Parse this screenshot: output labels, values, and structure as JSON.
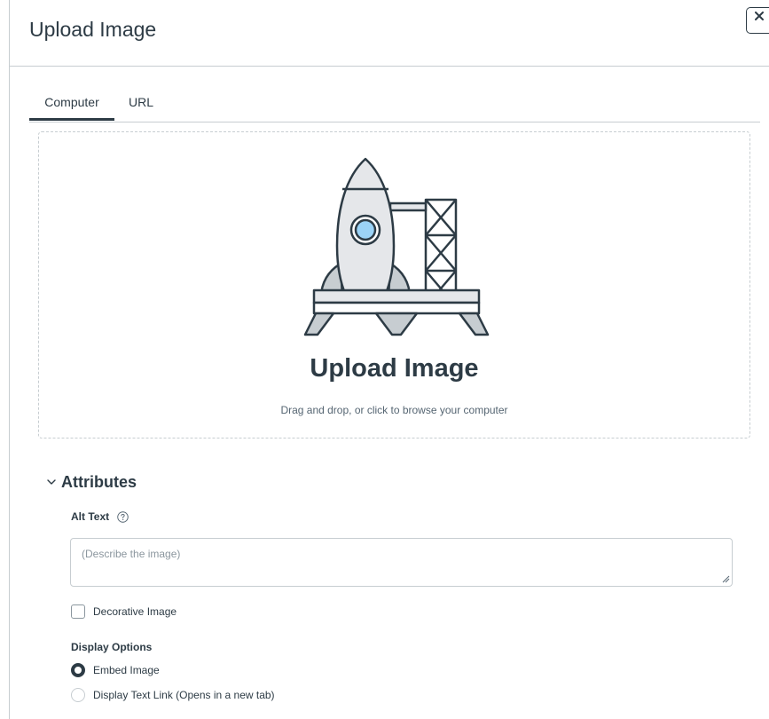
{
  "dialog": {
    "title": "Upload Image",
    "close_label": "×"
  },
  "tabs": [
    {
      "label": "Computer",
      "selected": true
    },
    {
      "label": "URL",
      "selected": false
    }
  ],
  "dropzone": {
    "title": "Upload Image",
    "hint": "Drag and drop, or click to browse your computer"
  },
  "attributes": {
    "label": "Attributes",
    "expanded": true,
    "alt_text": {
      "label": "Alt Text",
      "value": "",
      "placeholder": "(Describe the image)"
    },
    "decorative": {
      "label": "Decorative Image",
      "checked": false
    },
    "display_options": {
      "label": "Display Options",
      "options": [
        {
          "label": "Embed Image",
          "checked": true
        },
        {
          "label": "Display Text Link (Opens in a new tab)",
          "checked": false
        }
      ]
    }
  },
  "colors": {
    "text": "#2d3b45",
    "border": "#c7cdd1",
    "rocket_fill": "#e5e7ea",
    "porthole": "#9bd3f7"
  }
}
